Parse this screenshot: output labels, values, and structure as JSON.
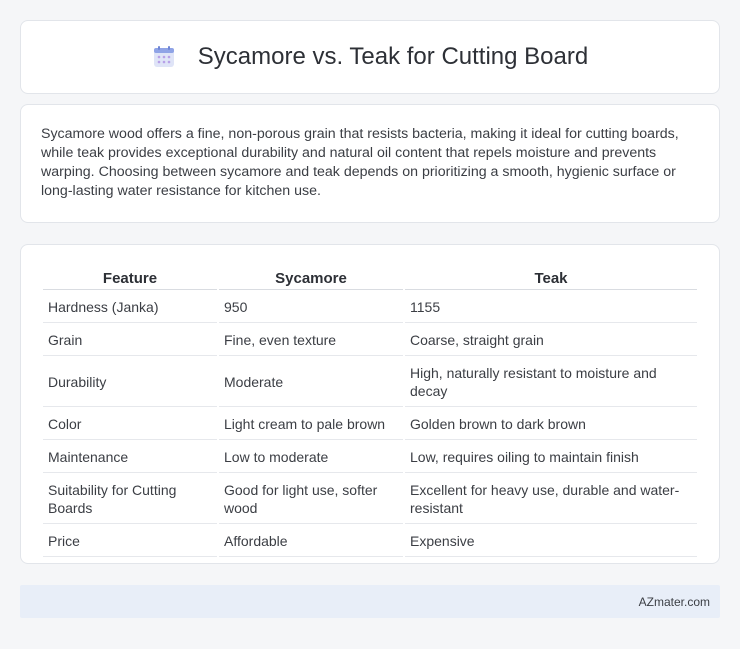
{
  "header": {
    "title": "Sycamore vs. Teak for Cutting Board",
    "icon": "calendar-icon"
  },
  "intro": {
    "text": "Sycamore wood offers a fine, non-porous grain that resists bacteria, making it ideal for cutting boards, while teak provides exceptional durability and natural oil content that repels moisture and prevents warping. Choosing between sycamore and teak depends on prioritizing a smooth, hygienic surface or long-lasting water resistance for kitchen use."
  },
  "table": {
    "headers": [
      "Feature",
      "Sycamore",
      "Teak"
    ],
    "rows": [
      [
        "Hardness (Janka)",
        "950",
        "1155"
      ],
      [
        "Grain",
        "Fine, even texture",
        "Coarse, straight grain"
      ],
      [
        "Durability",
        "Moderate",
        "High, naturally resistant to moisture and decay"
      ],
      [
        "Color",
        "Light cream to pale brown",
        "Golden brown to dark brown"
      ],
      [
        "Maintenance",
        "Low to moderate",
        "Low, requires oiling to maintain finish"
      ],
      [
        "Suitability for Cutting Boards",
        "Good for light use, softer wood",
        "Excellent for heavy use, durable and water-resistant"
      ],
      [
        "Price",
        "Affordable",
        "Expensive"
      ]
    ]
  },
  "footer": {
    "brand": "AZmater.com"
  }
}
